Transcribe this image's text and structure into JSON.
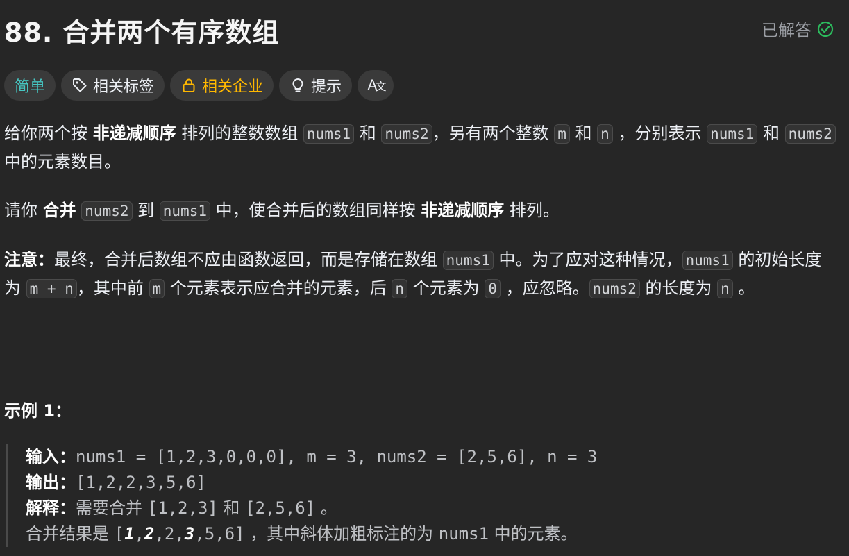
{
  "problem": {
    "title": "88. 合并两个有序数组",
    "status_label": "已解答"
  },
  "tags": {
    "difficulty": "简单",
    "related_tags": "相关标签",
    "related_companies": "相关企业",
    "hint": "提示",
    "font_icon": "A文"
  },
  "description": {
    "p1": {
      "t1": "给你两个按 ",
      "b1": "非递减顺序",
      "t2": " 排列的整数数组 ",
      "c1": "nums1",
      "t3": " 和 ",
      "c2": "nums2",
      "t4": "，另有两个整数 ",
      "c3": "m",
      "t5": " 和 ",
      "c4": "n",
      "t6": " ，分别表示 ",
      "c5": "nums1",
      "t7": " 和 ",
      "c6": "nums2",
      "t8": " 中的元素数目。"
    },
    "p2": {
      "t1": "请你 ",
      "b1": "合并",
      "t2": " ",
      "c1": "nums2",
      "t3": " 到 ",
      "c2": "nums1",
      "t4": " 中，使合并后的数组同样按 ",
      "b2": "非递减顺序",
      "t5": " 排列。"
    },
    "p3": {
      "b1": "注意：",
      "t1": "最终，合并后数组不应由函数返回，而是存储在数组 ",
      "c1": "nums1",
      "t2": " 中。为了应对这种情况，",
      "c2": "nums1",
      "t3": " 的初始长度为 ",
      "c3": "m + n",
      "t4": "，其中前 ",
      "c4": "m",
      "t5": " 个元素表示应合并的元素，后 ",
      "c5": "n",
      "t6": " 个元素为 ",
      "c6": "0",
      "t7": " ，应忽略。",
      "c7": "nums2",
      "t8": " 的长度为 ",
      "c8": "n",
      "t9": " 。"
    }
  },
  "example1": {
    "title": "示例 1：",
    "input_label": "输入：",
    "input_value": "nums1 = [1,2,3,0,0,0], m = 3, nums2 = [2,5,6], n = 3",
    "output_label": "输出：",
    "output_value": "[1,2,2,3,5,6]",
    "explain_label": "解释：",
    "explain_t1": "需要合并 ",
    "explain_c1": "[1,2,3]",
    "explain_t2": " 和 ",
    "explain_c2": "[2,5,6]",
    "explain_t3": " 。",
    "result_t1": "合并结果是 ",
    "result_open": "[",
    "result_b1": "1",
    "result_comma1": ",",
    "result_b2": "2",
    "result_mid": ",2,",
    "result_b3": "3",
    "result_tail": ",5,6]",
    "result_t2": " ，其中斜体加粗标注的为 ",
    "result_c1": "nums1",
    "result_t3": " 中的元素。"
  },
  "colors": {
    "background": "#262626",
    "easy": "#46c6c2",
    "company": "#ffb800",
    "solved_check": "#2cbb5d"
  }
}
